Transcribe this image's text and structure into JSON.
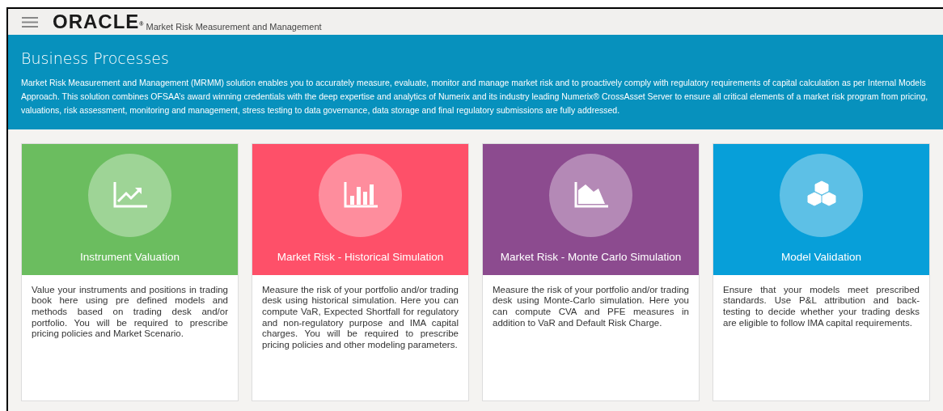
{
  "header": {
    "logo": "ORACLE$^{®}$",
    "app_title": "Market Risk Measurement and Management"
  },
  "banner": {
    "title": "Business Processes",
    "description": "Market Risk Measurement and Management (MRMM) solution enables you to accurately measure, evaluate, monitor and manage market risk and to proactively comply with regulatory requirements of capital calculation as per Internal Models Approach. This solution combines OFSAA’s award winning credentials with the deep expertise and analytics of Numerix and its industry leading Numerix® CrossAsset Server to ensure all critical elements of a market risk program from pricing, valuations, risk assessment, monitoring and management, stress testing to data governance, data storage and final regulatory submissions are fully addressed."
  },
  "cards": [
    {
      "kind": "trend",
      "color": "#6bbd5f",
      "title": "Instrument Valuation",
      "description": "Value your instruments and positions in trading book here using pre defined models and methods based on trading desk and/or portfolio. You will be required to prescribe pricing policies and Market Scenario."
    },
    {
      "kind": "bars",
      "color": "#fe5069",
      "title": "Market Risk - Historical Simulation",
      "description": "Measure the risk of your portfolio and/or trading desk using historical simulation. Here you can compute VaR, Expected Shortfall for regulatory and non-regulatory purpose and IMA capital charges. You will be required to prescribe pricing policies and other modeling parameters."
    },
    {
      "kind": "area",
      "color": "#8c4b8f",
      "title": "Market Risk - Monte Carlo Simulation",
      "description": "Measure the risk of your portfolio and/or trading desk using Monte-Carlo simulation. Here you can compute CVA and PFE measures in addition to VaR and Default Risk Charge."
    },
    {
      "kind": "cubes",
      "color": "#079fd9",
      "title": "Model Validation",
      "description": "Ensure that your models meet prescribed standards. Use P&L attribution and back-testing to decide whether your trading desks are eligible to follow IMA capital requirements."
    }
  ]
}
